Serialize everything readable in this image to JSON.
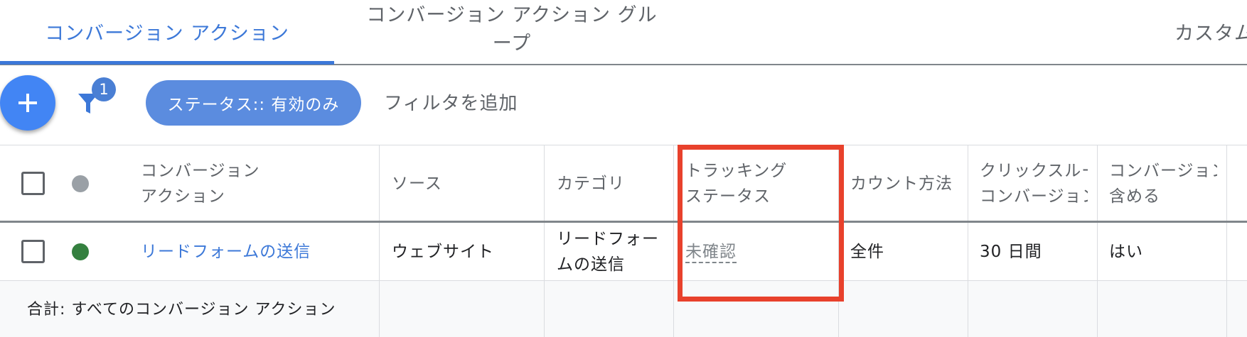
{
  "tabs": [
    {
      "label": "コンバージョン アクション"
    },
    {
      "label": "コンバージョン アクション グループ"
    },
    {
      "label": "カスタム"
    }
  ],
  "toolbar": {
    "filter_count": "1",
    "status_chip": "ステータス:: 有効のみ",
    "add_filter": "フィルタを追加"
  },
  "table": {
    "headers": {
      "name_1": "コンバージョン",
      "name_2": "アクション",
      "source": "ソース",
      "category": "カテゴリ",
      "tracking_1": "トラッキング",
      "tracking_2": "ステータス",
      "count": "カウント方法",
      "click_1": "クリックスルー",
      "click_2": "コンバージョン",
      "include_1": "コンバージョン",
      "include_2": "含める"
    },
    "row": {
      "name": "リードフォームの送信",
      "source": "ウェブサイト",
      "category_1": "リードフォー",
      "category_2": "ムの送信",
      "tracking": "未確認",
      "count": "全件",
      "click_window": "30 日間",
      "include": "はい"
    },
    "footer": "合計: すべてのコンバージョン アクション"
  },
  "colors": {
    "accent": "#3c78d8",
    "chip": "#5b8cdf",
    "status_enabled": "#34803f",
    "status_header": "#9aa0a6",
    "highlight": "#e8412c"
  }
}
